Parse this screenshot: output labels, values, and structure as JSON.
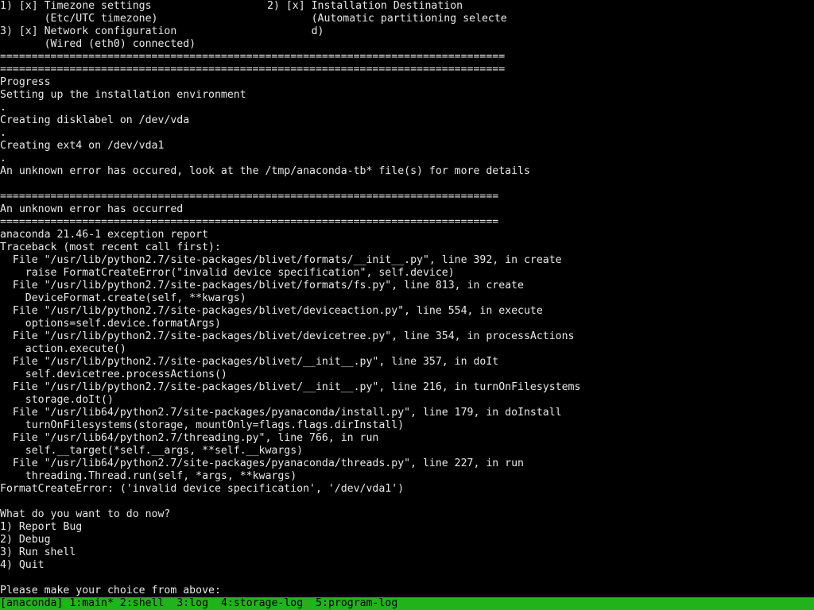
{
  "summary": {
    "items": [
      {
        "text": "1) [x] Timezone settings"
      },
      {
        "text": "       (Etc/UTC timezone)"
      },
      {
        "text": "3) [x] Network configuration"
      },
      {
        "text": "       (Wired (eth0) connected)"
      }
    ],
    "right": [
      {
        "text": "2) [x] Installation Destination"
      },
      {
        "text": "       (Automatic partitioning selecte"
      },
      {
        "text": "       d)"
      }
    ],
    "separator": "================================================================================"
  },
  "progress": {
    "separator": "================================================================================",
    "heading": "Progress",
    "lines": [
      "Setting up the installation environment",
      ".",
      "Creating disklabel on /dev/vda",
      ".",
      "Creating ext4 on /dev/vda1",
      ".",
      "",
      "An unknown error has occured, look at the /tmp/anaconda-tb* file(s) for more details"
    ]
  },
  "error": {
    "separator": "===============================================================================",
    "title": "An unknown error has occurred",
    "report": "anaconda 21.46-1 exception report",
    "traceback_header": "Traceback (most recent call first):",
    "traceback": [
      "  File \"/usr/lib/python2.7/site-packages/blivet/formats/__init__.py\", line 392, in create",
      "    raise FormatCreateError(\"invalid device specification\", self.device)",
      "  File \"/usr/lib/python2.7/site-packages/blivet/formats/fs.py\", line 813, in create",
      "    DeviceFormat.create(self, **kwargs)",
      "  File \"/usr/lib/python2.7/site-packages/blivet/deviceaction.py\", line 554, in execute",
      "    options=self.device.formatArgs)",
      "  File \"/usr/lib/python2.7/site-packages/blivet/devicetree.py\", line 354, in processActions",
      "    action.execute()",
      "  File \"/usr/lib/python2.7/site-packages/blivet/__init__.py\", line 357, in doIt",
      "    self.devicetree.processActions()",
      "  File \"/usr/lib/python2.7/site-packages/blivet/__init__.py\", line 216, in turnOnFilesystems",
      "    storage.doIt()",
      "  File \"/usr/lib64/python2.7/site-packages/pyanaconda/install.py\", line 179, in doInstall",
      "    turnOnFilesystems(storage, mountOnly=flags.flags.dirInstall)",
      "  File \"/usr/lib64/python2.7/threading.py\", line 766, in run",
      "    self.__target(*self.__args, **self.__kwargs)",
      "  File \"/usr/lib64/python2.7/site-packages/pyanaconda/threads.py\", line 227, in run",
      "    threading.Thread.run(self, *args, **kwargs)"
    ],
    "exception": "FormatCreateError: ('invalid device specification', '/dev/vda1')"
  },
  "menu": {
    "question": "What do you want to do now?",
    "options": [
      "1) Report Bug",
      "2) Debug",
      "3) Run shell",
      "4) Quit"
    ],
    "prompt": "Please make your choice from above: "
  },
  "status_bar": {
    "session": "[anaconda]",
    "tabs": [
      {
        "label": "1:main*"
      },
      {
        "label": "2:shell"
      },
      {
        "label": "3:log"
      },
      {
        "label": "4:storage-log"
      },
      {
        "label": "5:program-log"
      }
    ]
  },
  "colors": {
    "background": "#000000",
    "text": "#e8e8e8",
    "status_bar": "#22b21c",
    "status_text": "#000000"
  }
}
